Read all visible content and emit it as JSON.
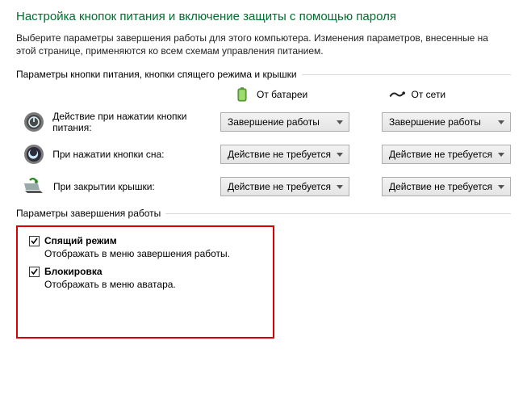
{
  "title": "Настройка кнопок питания и включение защиты с помощью пароля",
  "description": "Выберите параметры завершения работы для этого компьютера. Изменения параметров, внесенные на этой странице, применяются ко всем схемам управления питанием.",
  "group_buttons_label": "Параметры кнопки питания, кнопки спящего режима и крышки",
  "columns": {
    "battery": "От батареи",
    "plugged": "От сети"
  },
  "rows": [
    {
      "label": "Действие при нажатии кнопки питания:",
      "battery": "Завершение работы",
      "plugged": "Завершение работы"
    },
    {
      "label": "При нажатии кнопки сна:",
      "battery": "Действие не требуется",
      "plugged": "Действие не требуется"
    },
    {
      "label": "При закрытии крышки:",
      "battery": "Действие не требуется",
      "plugged": "Действие не требуется"
    }
  ],
  "group_shutdown_label": "Параметры завершения работы",
  "shutdown_options": [
    {
      "title": "Спящий режим",
      "desc": "Отображать в меню завершения работы.",
      "checked": true
    },
    {
      "title": "Блокировка",
      "desc": "Отображать в меню аватара.",
      "checked": true
    }
  ]
}
